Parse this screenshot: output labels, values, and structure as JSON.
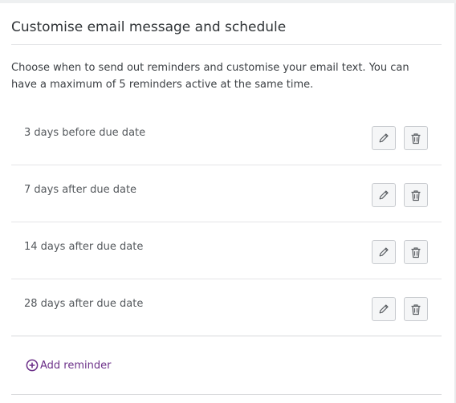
{
  "section": {
    "title": "Customise email message and schedule",
    "description": "Choose when to send out reminders and customise your email text. You can have a maximum of 5 reminders active at the same time."
  },
  "reminders": [
    {
      "label": "3 days before due date"
    },
    {
      "label": "7 days after due date"
    },
    {
      "label": "14 days after due date"
    },
    {
      "label": "28 days after due date"
    }
  ],
  "actions": {
    "edit_icon": "pencil-icon",
    "delete_icon": "trash-icon",
    "add_label": "Add reminder",
    "add_icon": "plus-circle-icon"
  },
  "colors": {
    "accent": "#6b2f88",
    "text": "#2f3336",
    "muted_text": "#55595d",
    "button_border": "#c8cbcf",
    "button_bg": "#f5f6f7"
  }
}
